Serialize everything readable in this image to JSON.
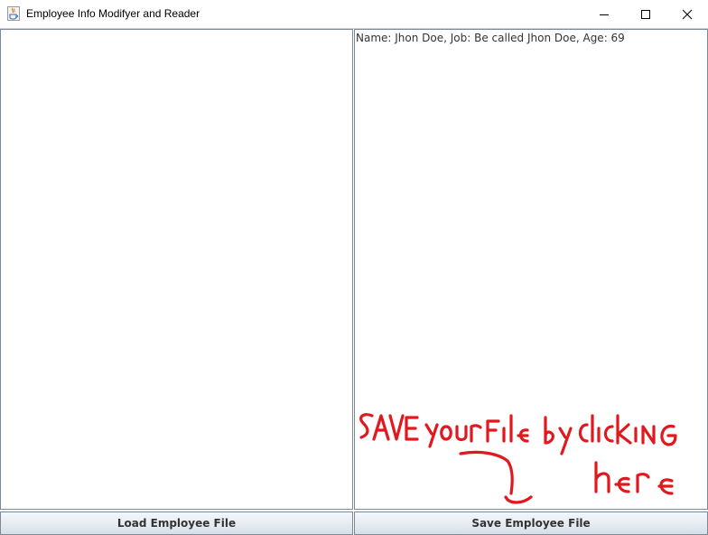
{
  "window": {
    "title": "Employee Info Modifyer and Reader",
    "icon": "java-cup-icon",
    "controls": [
      "minimize-icon",
      "maximize-icon",
      "close-icon"
    ]
  },
  "panes": {
    "left": {
      "text": ""
    },
    "right": {
      "text": "Name: Jhon Doe, Job: Be called Jhon Doe, Age: 69"
    }
  },
  "buttons": {
    "load_label": "Load Employee File",
    "save_label": "Save Employee File"
  },
  "annotation": {
    "text": "Save your file by clicking here",
    "color": "#e0191f"
  }
}
